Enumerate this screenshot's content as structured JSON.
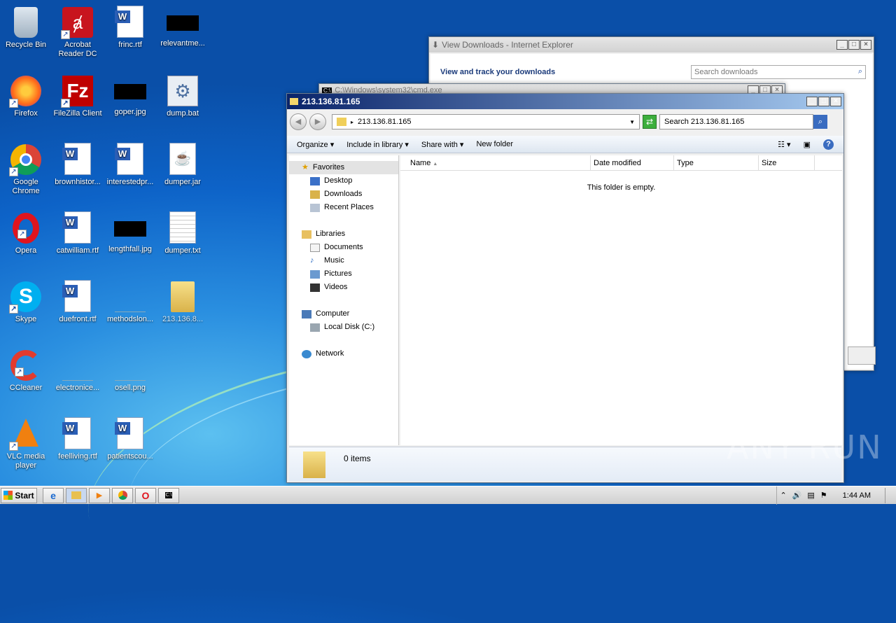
{
  "desktop": {
    "col1": [
      "Recycle Bin",
      "Firefox",
      "Google Chrome",
      "Opera",
      "Skype",
      "CCleaner",
      "VLC media player"
    ],
    "col2": [
      "Acrobat Reader DC",
      "FileZilla Client",
      "brownhistor...",
      "catwilliam.rtf",
      "duefront.rtf",
      "electronice...",
      "feelliving.rtf"
    ],
    "col3": [
      "frinc.rtf",
      "goper.jpg",
      "interestedpr...",
      "lengthfall.jpg",
      "methodslon...",
      "osell.png",
      "patientscou..."
    ],
    "col4": [
      "relevantme...",
      "dump.bat",
      "dumper.jar",
      "dumper.txt",
      "213.136.8..."
    ]
  },
  "ie_window": {
    "title": "View Downloads - Internet Explorer",
    "heading": "View and track your downloads",
    "search_placeholder": "Search downloads"
  },
  "cmd_window": {
    "title": "C:\\Windows\\system32\\cmd.exe"
  },
  "explorer": {
    "title": "213.136.81.165",
    "address": "213.136.81.165",
    "search_placeholder": "Search 213.136.81.165",
    "toolbar": {
      "organize": "Organize",
      "include": "Include in library",
      "share": "Share with",
      "newfolder": "New folder"
    },
    "nav": {
      "favorites": "Favorites",
      "desktop": "Desktop",
      "downloads": "Downloads",
      "recent": "Recent Places",
      "libraries": "Libraries",
      "documents": "Documents",
      "music": "Music",
      "pictures": "Pictures",
      "videos": "Videos",
      "computer": "Computer",
      "localdisk": "Local Disk (C:)",
      "network": "Network"
    },
    "columns": {
      "name": "Name",
      "date": "Date modified",
      "type": "Type",
      "size": "Size"
    },
    "empty": "This folder is empty.",
    "status": "0 items"
  },
  "taskbar": {
    "start": "Start",
    "clock": "1:44 AM"
  },
  "watermark": "ANY RUN"
}
